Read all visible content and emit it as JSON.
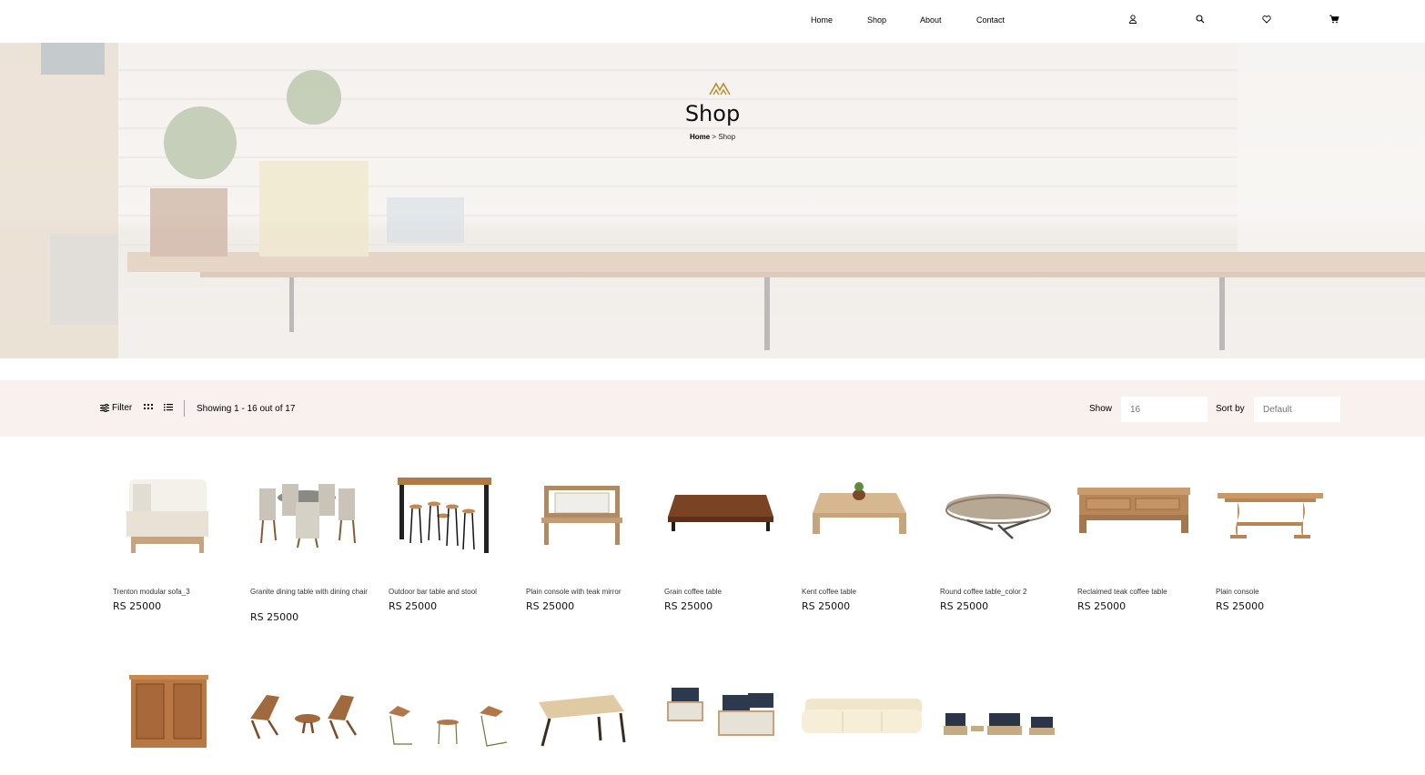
{
  "nav": {
    "items": [
      "Home",
      "Shop",
      "About",
      "Contact"
    ]
  },
  "header_icons": [
    "user-icon",
    "search-icon",
    "heart-icon",
    "cart-icon"
  ],
  "hero": {
    "title": "Shop",
    "breadcrumb_home": "Home",
    "breadcrumb_sep": " > ",
    "breadcrumb_current": "Shop"
  },
  "toolbar": {
    "filter_label": "Filter",
    "showing_text": "Showing 1 - 16 out of 17",
    "show_label": "Show",
    "show_placeholder": "16",
    "sort_label": "Sort by",
    "sort_placeholder": "Default"
  },
  "colors": {
    "accent": "#B88E2F",
    "toolbar_bg": "#F9F1EE",
    "placeholder": "#9F9F9F"
  },
  "products": [
    {
      "name": "Trenton modular sofa_3",
      "price": "RS 25000"
    },
    {
      "name": "Granite dining table with dining chair",
      "price": "RS 25000"
    },
    {
      "name": "Outdoor bar table and stool",
      "price": "RS 25000"
    },
    {
      "name": "Plain console with teak mirror",
      "price": "RS 25000"
    },
    {
      "name": "Grain coffee table",
      "price": "RS 25000"
    },
    {
      "name": "Kent coffee table",
      "price": "RS 25000"
    },
    {
      "name": "Round coffee table_color 2",
      "price": "RS 25000"
    },
    {
      "name": "Reclaimed teak coffee table",
      "price": "RS 25000"
    },
    {
      "name": "Plain console",
      "price": "RS 25000"
    }
  ]
}
